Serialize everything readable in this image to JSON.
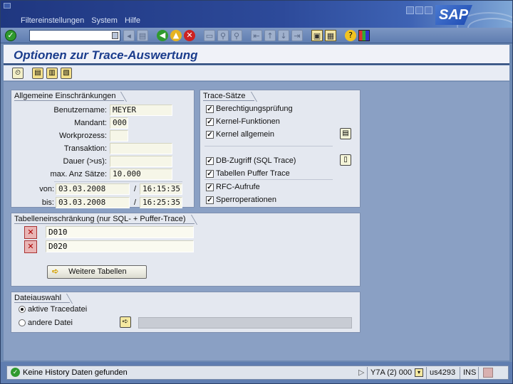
{
  "window": {
    "menu": [
      "Filtereinstellungen",
      "System",
      "Hilfe"
    ],
    "logo": "SAP"
  },
  "screen": {
    "title": "Optionen zur Trace-Auswertung"
  },
  "allgemein": {
    "title": "Allgemeine Einschränkungen",
    "fields": [
      {
        "label": "Benutzername:",
        "value": "MEYER"
      },
      {
        "label": "Mandant:",
        "value": "000"
      },
      {
        "label": "Workprozess:",
        "value": ""
      },
      {
        "label": "Transaktion:",
        "value": ""
      },
      {
        "label": "Dauer (>us):",
        "value": ""
      },
      {
        "label": "max. Anz Sätze:",
        "value": "10.000"
      }
    ],
    "von": {
      "label": "von:",
      "date": "03.03.2008",
      "sep": "/",
      "time": "16:15:35"
    },
    "bis": {
      "label": "bis:",
      "date": "03.03.2008",
      "sep": "/",
      "time": "16:25:35"
    }
  },
  "trace": {
    "title": "Trace-Sätze",
    "items": [
      {
        "label": "Berechtigungsprüfung",
        "checked": true
      },
      {
        "label": "Kernel-Funktionen",
        "checked": true
      },
      {
        "label": "Kernel allgemein",
        "checked": true
      },
      {
        "label": "DB-Zugriff (SQL Trace)",
        "checked": true
      },
      {
        "label": "Tabellen Puffer Trace",
        "checked": true
      },
      {
        "label": "RFC-Aufrufe",
        "checked": true
      },
      {
        "label": "Sperroperationen",
        "checked": true
      }
    ]
  },
  "tabellen": {
    "title": "Tabelleneinschränkung (nur SQL- + Puffer-Trace)",
    "rows": [
      "D010",
      "D020"
    ],
    "button": "Weitere Tabellen"
  },
  "datei": {
    "title": "Dateiauswahl",
    "options": [
      {
        "label": "aktive Tracedatei",
        "selected": true
      },
      {
        "label": "andere Datei",
        "selected": false
      }
    ]
  },
  "status": {
    "message": "Keine History Daten gefunden",
    "system": "Y7A (2) 000",
    "server": "us4293",
    "mode": "INS"
  }
}
